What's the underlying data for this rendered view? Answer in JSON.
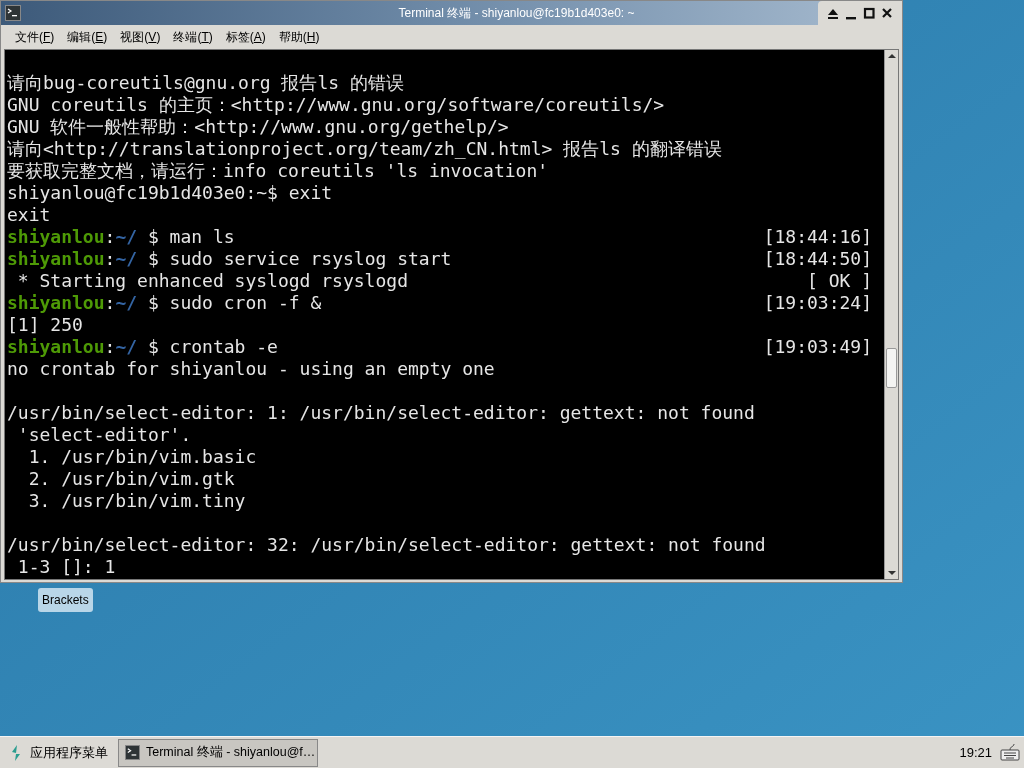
{
  "window": {
    "title": "Terminal 终端 - shiyanlou@fc19b1d403e0: ~"
  },
  "menu": [
    {
      "before": "文件(",
      "key": "F",
      "after": ")"
    },
    {
      "before": "编辑(",
      "key": "E",
      "after": ")"
    },
    {
      "before": "视图(",
      "key": "V",
      "after": ")"
    },
    {
      "before": "终端(",
      "key": "T",
      "after": ")"
    },
    {
      "before": "标签(",
      "key": "A",
      "after": ")"
    },
    {
      "before": "帮助(",
      "key": "H",
      "after": ")"
    }
  ],
  "terminal_lines": [
    {
      "kind": "text",
      "segments": [
        {
          "kind": "plain",
          "text": "请向bug-coreutils@gnu.org 报告ls 的错误"
        }
      ]
    },
    {
      "kind": "text",
      "segments": [
        {
          "kind": "plain",
          "text": "GNU coreutils 的主页：<http://www.gnu.org/software/coreutils/>"
        }
      ]
    },
    {
      "kind": "text",
      "segments": [
        {
          "kind": "plain",
          "text": "GNU 软件一般性帮助：<http://www.gnu.org/gethelp/>"
        }
      ]
    },
    {
      "kind": "text",
      "segments": [
        {
          "kind": "plain",
          "text": "请向<http://translationproject.org/team/zh_CN.html> 报告ls 的翻译错误"
        }
      ]
    },
    {
      "kind": "text",
      "segments": [
        {
          "kind": "plain",
          "text": "要获取完整文档，请运行：info coreutils 'ls invocation'"
        }
      ]
    },
    {
      "kind": "text",
      "segments": [
        {
          "kind": "plain",
          "text": "shiyanlou@fc19b1d403e0:~$ exit"
        }
      ]
    },
    {
      "kind": "text",
      "segments": [
        {
          "kind": "plain",
          "text": "exit"
        }
      ]
    },
    {
      "kind": "text",
      "segments": [
        {
          "kind": "user",
          "text": "shiyanlou"
        },
        {
          "kind": "plain",
          "text": ":"
        },
        {
          "kind": "path",
          "text": "~/"
        },
        {
          "kind": "plain",
          "text": " $ man ls"
        }
      ],
      "right": "[18:44:16]"
    },
    {
      "kind": "text",
      "segments": [
        {
          "kind": "user",
          "text": "shiyanlou"
        },
        {
          "kind": "plain",
          "text": ":"
        },
        {
          "kind": "path",
          "text": "~/"
        },
        {
          "kind": "plain",
          "text": " $ sudo service rsyslog start"
        }
      ],
      "right": "[18:44:50]"
    },
    {
      "kind": "text",
      "segments": [
        {
          "kind": "plain",
          "text": " * Starting enhanced syslogd rsyslogd"
        }
      ],
      "right": "[ OK ]"
    },
    {
      "kind": "text",
      "segments": [
        {
          "kind": "user",
          "text": "shiyanlou"
        },
        {
          "kind": "plain",
          "text": ":"
        },
        {
          "kind": "path",
          "text": "~/"
        },
        {
          "kind": "plain",
          "text": " $ sudo cron -f &"
        }
      ],
      "right": "[19:03:24]"
    },
    {
      "kind": "text",
      "segments": [
        {
          "kind": "plain",
          "text": "[1] 250"
        }
      ]
    },
    {
      "kind": "text",
      "segments": [
        {
          "kind": "user",
          "text": "shiyanlou"
        },
        {
          "kind": "plain",
          "text": ":"
        },
        {
          "kind": "path",
          "text": "~/"
        },
        {
          "kind": "plain",
          "text": " $ crontab -e"
        }
      ],
      "right": "[19:03:49]"
    },
    {
      "kind": "text",
      "segments": [
        {
          "kind": "plain",
          "text": "no crontab for shiyanlou - using an empty one"
        }
      ]
    },
    {
      "kind": "blank"
    },
    {
      "kind": "text",
      "segments": [
        {
          "kind": "plain",
          "text": "/usr/bin/select-editor: 1: /usr/bin/select-editor: gettext: not found"
        }
      ]
    },
    {
      "kind": "text",
      "segments": [
        {
          "kind": "plain",
          "text": " 'select-editor'."
        }
      ]
    },
    {
      "kind": "text",
      "segments": [
        {
          "kind": "plain",
          "text": "  1. /usr/bin/vim.basic"
        }
      ]
    },
    {
      "kind": "text",
      "segments": [
        {
          "kind": "plain",
          "text": "  2. /usr/bin/vim.gtk"
        }
      ]
    },
    {
      "kind": "text",
      "segments": [
        {
          "kind": "plain",
          "text": "  3. /usr/bin/vim.tiny"
        }
      ]
    },
    {
      "kind": "blank"
    },
    {
      "kind": "text",
      "segments": [
        {
          "kind": "plain",
          "text": "/usr/bin/select-editor: 32: /usr/bin/select-editor: gettext: not found"
        }
      ]
    },
    {
      "kind": "text",
      "segments": [
        {
          "kind": "plain",
          "text": " 1-3 []: 1"
        }
      ]
    }
  ],
  "desktop_icons": [
    {
      "label": "Brackets"
    }
  ],
  "taskbar": {
    "menu_label": "应用程序菜单",
    "tasks": [
      {
        "label": "Terminal 终端 - shiyanlou@f…",
        "selected": true
      }
    ],
    "clock": "19:21"
  }
}
